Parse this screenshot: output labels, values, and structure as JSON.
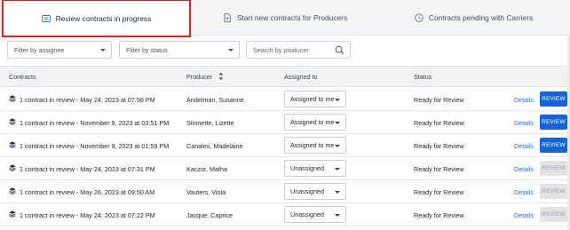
{
  "tabs": [
    {
      "label": "Review contracts in progress",
      "icon": "contract-list-icon",
      "active": true
    },
    {
      "label": "Start new contracts for Producers",
      "icon": "add-document-icon",
      "active": false
    },
    {
      "label": "Contracts pending with Carriers",
      "icon": "clock-icon",
      "active": false
    }
  ],
  "filters": {
    "assignee_placeholder": "Filter by assignee",
    "status_placeholder": "Filter by status",
    "producer_search_placeholder": "Search by producer"
  },
  "table": {
    "headers": {
      "contracts": "Contracts",
      "producer": "Producer",
      "assigned_to": "Assigned to",
      "status": "Status"
    },
    "details_label": "Details",
    "review_label": "REVIEW",
    "rows": [
      {
        "contract": "1 contract in review - May 24, 2023 at 07:56 PM",
        "producer": "Andelman, Susanne",
        "assigned": "Assigned to me",
        "status": "Ready for Review",
        "review_enabled": true
      },
      {
        "contract": "1 contract in review - November 9, 2023 at 03:51 PM",
        "producer": "Stinnette, Lizette",
        "assigned": "Assigned to me",
        "status": "Ready for Review",
        "review_enabled": true
      },
      {
        "contract": "1 contract in review - November 9, 2023 at 01:59 PM",
        "producer": "Canales, Madelaine",
        "assigned": "Assigned to me",
        "status": "Ready for Review",
        "review_enabled": true
      },
      {
        "contract": "1 contract in review - May 24, 2023 at 07:31 PM",
        "producer": "Kaczor, Matha",
        "assigned": "Unassigned",
        "status": "Ready for Review",
        "review_enabled": false
      },
      {
        "contract": "1 contract in review - May 26, 2023 at 09:50 AM",
        "producer": "Vauters, Viola",
        "assigned": "Unassigned",
        "status": "Ready for Review",
        "review_enabled": false
      },
      {
        "contract": "1 contract in review - May 24, 2023 at 07:22 PM",
        "producer": "Jacque, Caprice",
        "assigned": "Unassigned",
        "status": "Ready for Review",
        "review_enabled": false
      }
    ]
  },
  "colors": {
    "accent": "#1565d8",
    "highlight_border": "#e02020",
    "link": "#1f6fd6",
    "disabled_button": "#e2e3e5"
  }
}
